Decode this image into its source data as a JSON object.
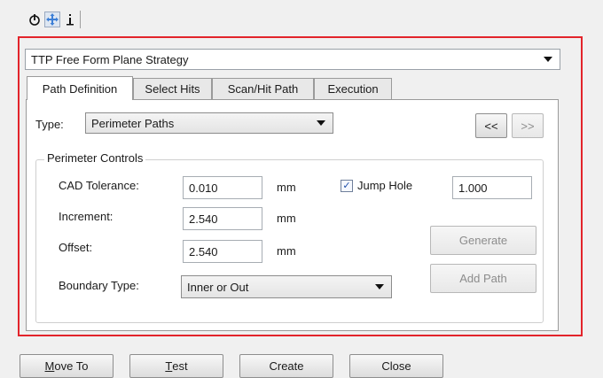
{
  "toolbar": {
    "icons": [
      "power-icon",
      "move-cross-icon",
      "info-icon"
    ]
  },
  "strategy": {
    "selected": "TTP Free Form Plane Strategy"
  },
  "tabs": [
    {
      "label": "Path Definition",
      "active": true
    },
    {
      "label": "Select Hits",
      "active": false
    },
    {
      "label": "Scan/Hit Path",
      "active": false
    },
    {
      "label": "Execution",
      "active": false
    }
  ],
  "type": {
    "label": "Type:",
    "selected": "Perimeter Paths"
  },
  "nav": {
    "prev": "<<",
    "next": ">>"
  },
  "perimeter": {
    "title": "Perimeter Controls",
    "cad_tolerance": {
      "label": "CAD Tolerance:",
      "value": "0.010",
      "unit": "mm"
    },
    "increment": {
      "label": "Increment:",
      "value": "2.540",
      "unit": "mm"
    },
    "offset": {
      "label": "Offset:",
      "value": "2.540",
      "unit": "mm"
    },
    "jump_hole": {
      "label": "Jump Hole",
      "checked": true,
      "value": "1.000"
    },
    "boundary": {
      "label": "Boundary Type:",
      "selected": "Inner or Out"
    }
  },
  "actions": {
    "generate": "Generate",
    "add_path": "Add Path"
  },
  "footer": {
    "move_to": {
      "prefix": "M",
      "rest": "ove To"
    },
    "test": {
      "prefix": "T",
      "rest": "est"
    },
    "create": "Create",
    "close": "Close"
  },
  "colors": {
    "highlight_border": "#e3242b",
    "checkmark": "#1d4da8"
  }
}
